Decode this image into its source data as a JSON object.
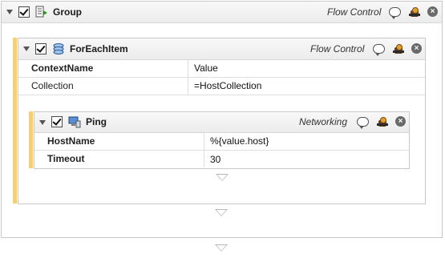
{
  "group": {
    "title": "Group",
    "category": "Flow Control",
    "enabled": true,
    "icon": "group-icon"
  },
  "foreach": {
    "title": "ForEachItem",
    "category": "Flow Control",
    "enabled": true,
    "icon": "foreach-icon",
    "properties": [
      {
        "name": "ContextName",
        "value": "Value",
        "bold": true
      },
      {
        "name": "Collection",
        "value": "=HostCollection",
        "bold": false
      }
    ]
  },
  "ping": {
    "title": "Ping",
    "category": "Networking",
    "enabled": true,
    "icon": "network-icon",
    "properties": [
      {
        "name": "HostName",
        "value": "%{value.host}",
        "bold": true
      },
      {
        "name": "Timeout",
        "value": "30",
        "bold": true
      }
    ]
  },
  "colors": {
    "accent": "#f3cf78",
    "border": "#c9c9c9"
  }
}
